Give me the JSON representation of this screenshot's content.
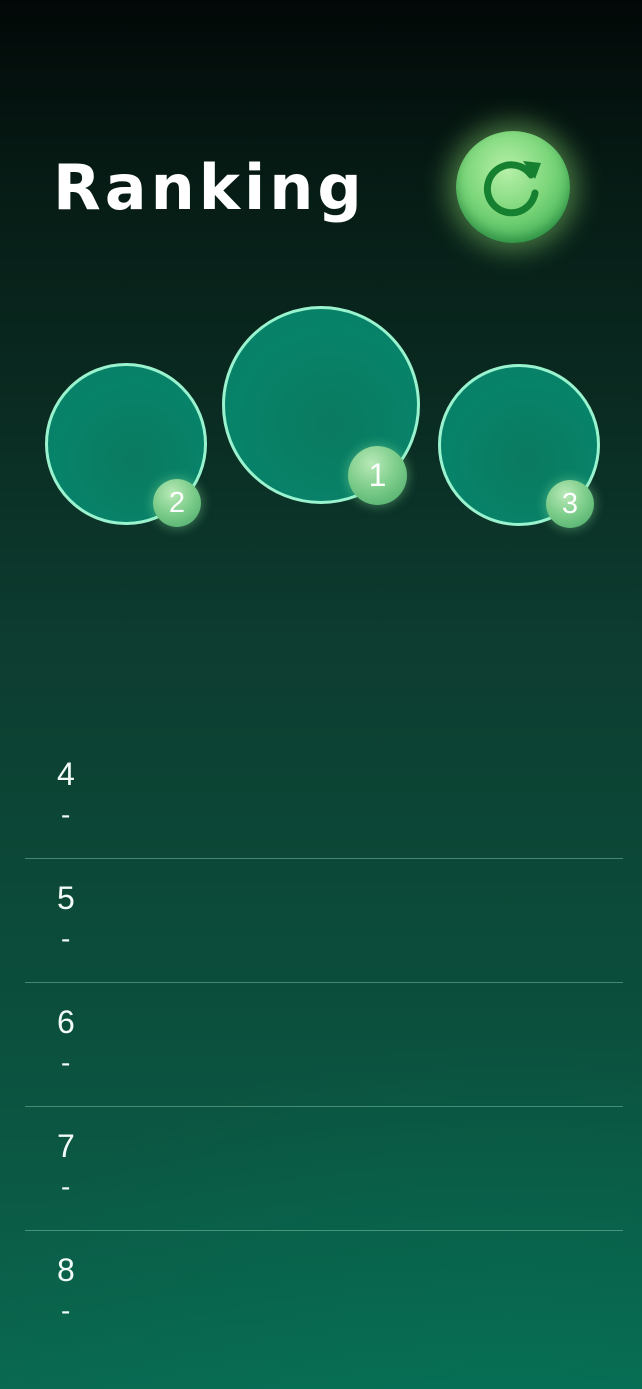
{
  "header": {
    "title": "Ranking",
    "refresh_icon": "refresh-icon"
  },
  "podium": [
    {
      "rank": "1"
    },
    {
      "rank": "2"
    },
    {
      "rank": "3"
    }
  ],
  "list": [
    {
      "rank": "4",
      "name": "-"
    },
    {
      "rank": "5",
      "name": "-"
    },
    {
      "rank": "6",
      "name": "-"
    },
    {
      "rank": "7",
      "name": "-"
    },
    {
      "rank": "8",
      "name": "-"
    }
  ],
  "colors": {
    "accent": "#7cd67a",
    "podium_border": "#9af3cf",
    "podium_fill": "#07836a",
    "background_top": "#020807",
    "background_bottom": "#0a6850"
  }
}
